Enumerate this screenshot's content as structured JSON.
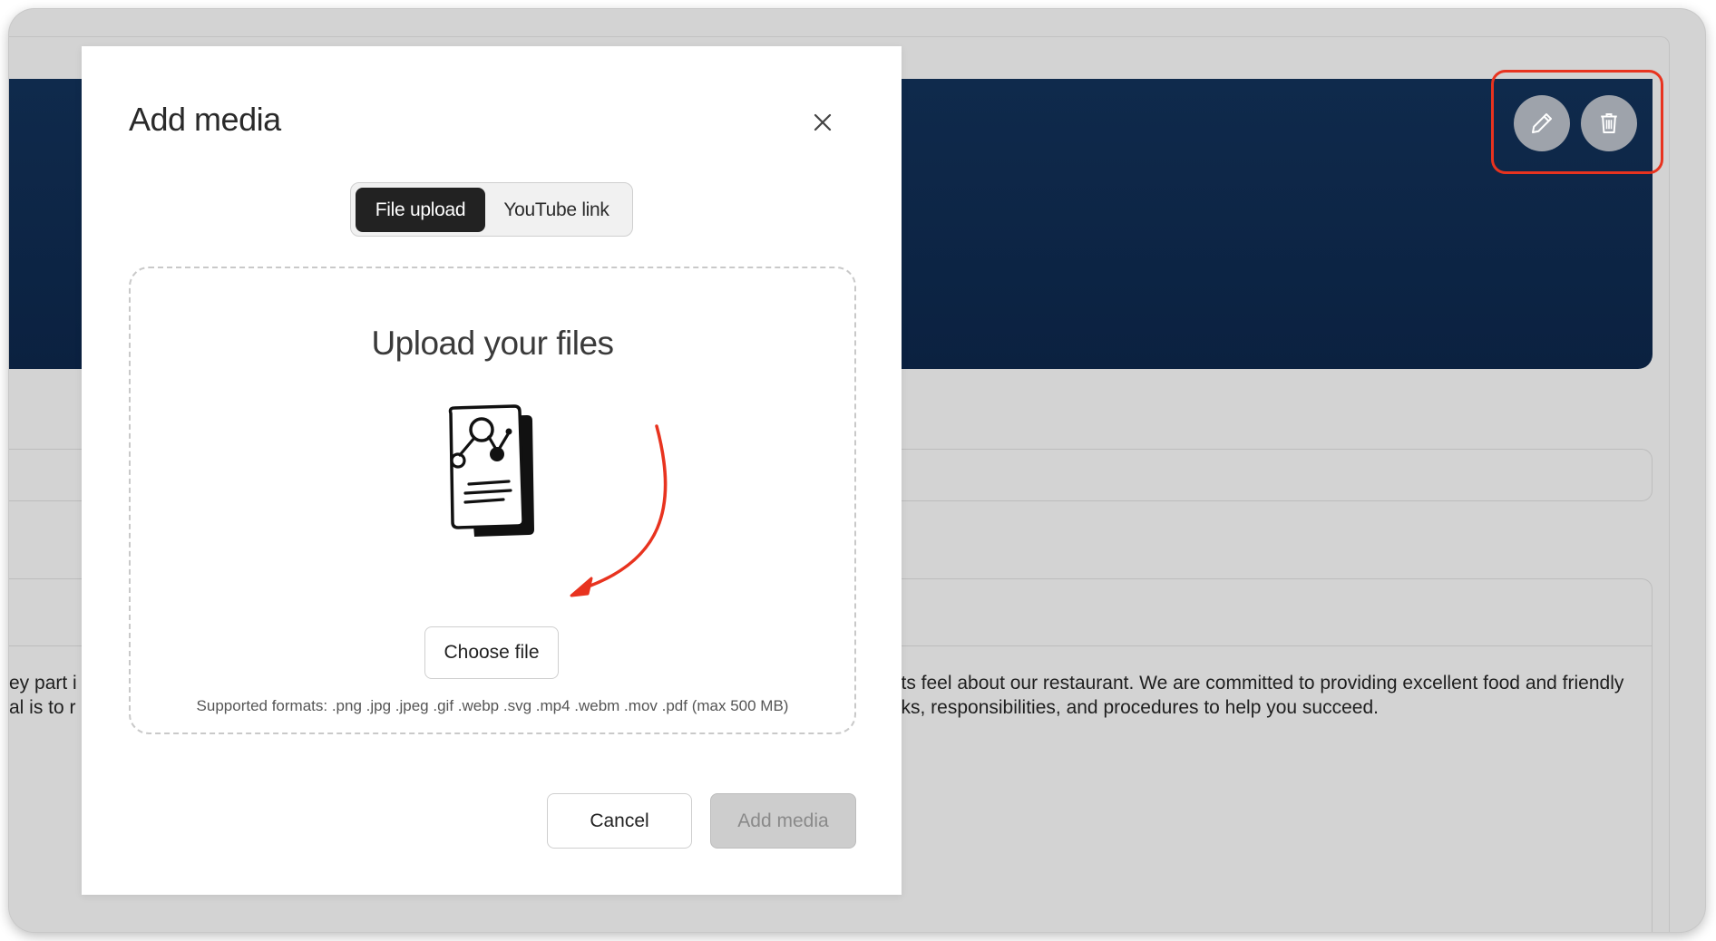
{
  "background": {
    "hero_color": "#0f2a4c",
    "edit_button_icon": "pencil-icon",
    "delete_button_icon": "trash-icon",
    "text_left_line1": "ey part i",
    "text_left_line2": "al is to r",
    "text_right_line1": "sts feel about our restaurant. We are committed to providing excellent food and friendly",
    "text_right_line2": "sks, responsibilities, and procedures to help you succeed."
  },
  "modal": {
    "title": "Add media",
    "close_icon": "close-icon",
    "tabs": [
      {
        "label": "File upload",
        "active": true
      },
      {
        "label": "YouTube link",
        "active": false
      }
    ],
    "dropzone": {
      "title": "Upload your files",
      "illustration": "document-icon",
      "choose_label": "Choose file",
      "formats": "Supported formats: .png .jpg .jpeg .gif .webp .svg .mp4 .webm .mov .pdf (max 500 MB)"
    },
    "cancel_label": "Cancel",
    "add_label": "Add media"
  },
  "annotation": {
    "highlight_color": "#e8331f"
  }
}
